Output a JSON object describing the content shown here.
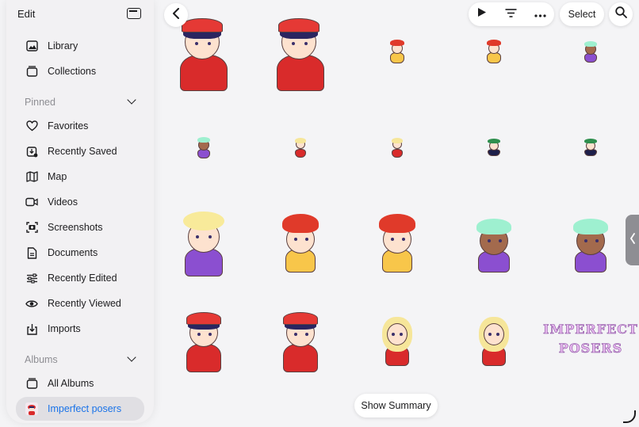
{
  "sidebar": {
    "edit_label": "Edit",
    "top_items": [
      {
        "label": "Library",
        "icon": "photo-library-icon"
      },
      {
        "label": "Collections",
        "icon": "collections-icon"
      }
    ],
    "pinned_label": "Pinned",
    "pinned_items": [
      {
        "label": "Favorites",
        "icon": "heart-icon"
      },
      {
        "label": "Recently Saved",
        "icon": "recently-saved-icon"
      },
      {
        "label": "Map",
        "icon": "map-icon"
      },
      {
        "label": "Videos",
        "icon": "video-icon"
      },
      {
        "label": "Screenshots",
        "icon": "screenshot-icon"
      },
      {
        "label": "Documents",
        "icon": "document-icon"
      },
      {
        "label": "Recently Edited",
        "icon": "sliders-icon"
      },
      {
        "label": "Recently Viewed",
        "icon": "eye-icon"
      },
      {
        "label": "Imports",
        "icon": "import-icon"
      }
    ],
    "albums_label": "Albums",
    "album_items": [
      {
        "label": "All Albums",
        "icon": "albums-icon"
      },
      {
        "label": "Imperfect posers",
        "icon": "album-thumbnail-icon",
        "active": true
      }
    ]
  },
  "toolbar": {
    "select_label": "Select"
  },
  "grid": {
    "logo_line1": "IMPERFECT",
    "logo_line2": "POSERS"
  },
  "summary_label": "Show Summary",
  "colors": {
    "accent": "#1a73e8",
    "red_shirt": "#d92b2b",
    "purple_shirt": "#8b4fd0",
    "yellow_shirt": "#f8c64a"
  }
}
